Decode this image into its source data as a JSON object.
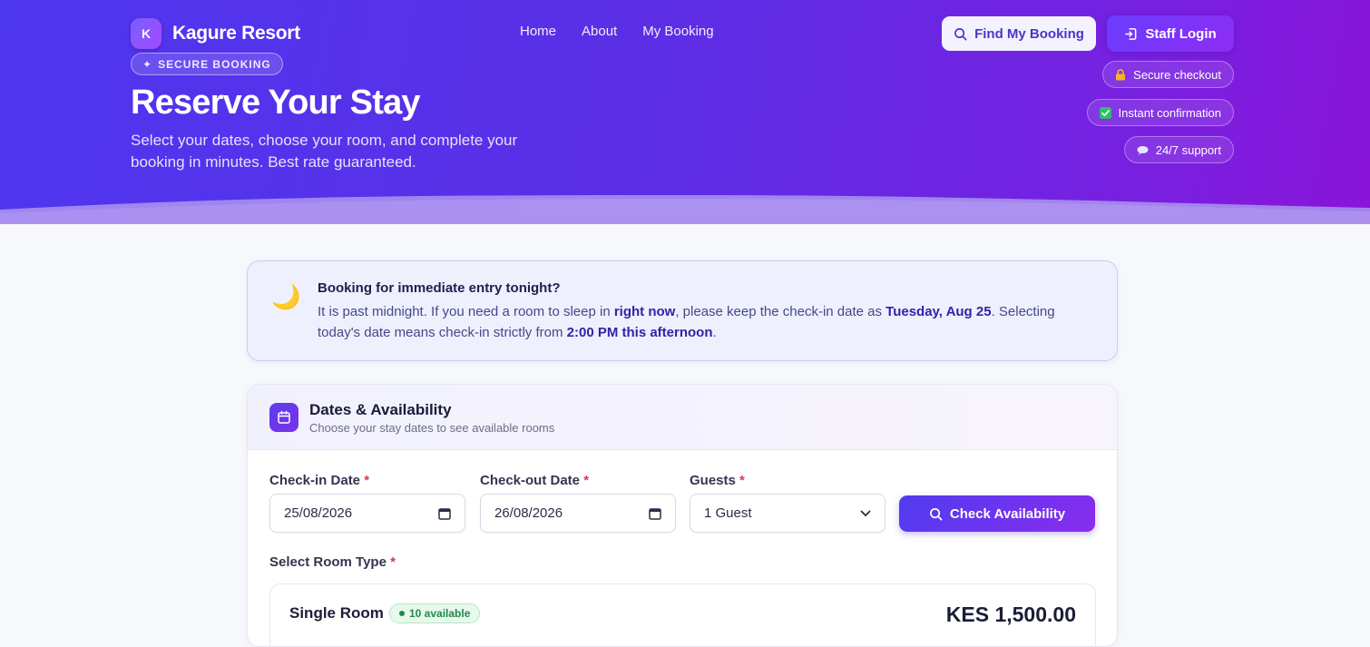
{
  "brand": {
    "logo_letter": "K",
    "name": "Kagure Resort"
  },
  "nav": {
    "items": [
      "Home",
      "About",
      "My Booking"
    ]
  },
  "header_actions": {
    "find_label": "Find My Booking",
    "staff_label": "Staff Login"
  },
  "hero": {
    "badge": "SECURE BOOKING",
    "title": "Reserve Your Stay",
    "subtitle": "Select your dates, choose your room, and complete your booking in minutes. Best rate guaranteed."
  },
  "trust_pills": [
    {
      "icon": "lock-icon",
      "label": "Secure checkout"
    },
    {
      "icon": "check-icon",
      "label": "Instant confirmation"
    },
    {
      "icon": "chat-icon",
      "label": "24/7 support"
    }
  ],
  "notice": {
    "title": "Booking for immediate entry tonight?",
    "text_1": "It is past midnight. If you need a room to sleep in ",
    "bold_1": "right now",
    "text_2": ", please keep the check-in date as ",
    "bold_2": "Tuesday, Aug 25",
    "text_3": ". Selecting today's date means check-in strictly from ",
    "bold_3": "2:00 PM this afternoon",
    "text_4": "."
  },
  "availability": {
    "title": "Dates & Availability",
    "subtitle": "Choose your stay dates to see available rooms",
    "checkin_label": "Check-in Date",
    "checkin_value": "25/08/2026",
    "checkout_label": "Check-out Date",
    "checkout_value": "26/08/2026",
    "guests_label": "Guests",
    "guests_value": "1 Guest",
    "required_mark": "*",
    "check_button": "Check Availability",
    "room_type_label": "Select Room Type"
  },
  "room": {
    "name": "Single Room",
    "availability": "10 available",
    "price": "KES 1,500.00"
  },
  "colors": {
    "accent": "#5a33f0",
    "accent_end": "#8a14d8",
    "success": "#1f8a48",
    "required": "#e0344c"
  }
}
